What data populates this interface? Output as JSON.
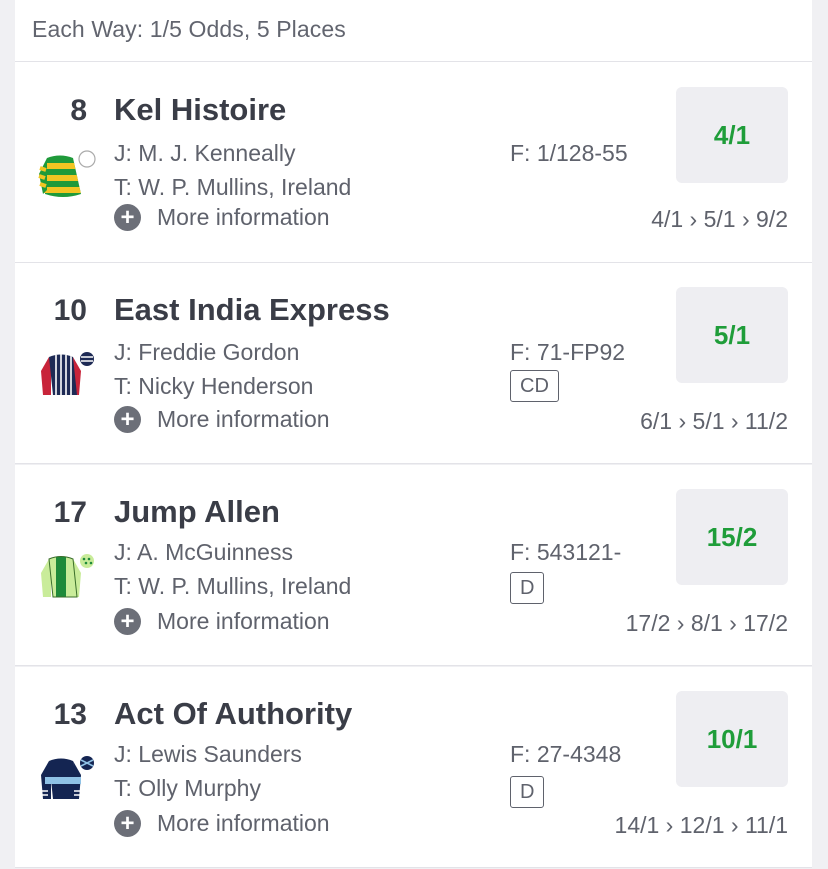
{
  "header": {
    "each_way": "Each Way: 1/5 Odds, 5 Places"
  },
  "more_label": "More information",
  "runners": [
    {
      "number": "8",
      "name": "Kel Histoire",
      "jockey": "J: M. J. Kenneally",
      "trainer": "T: W. P. Mullins, Ireland",
      "form": "F: 1/128-55",
      "badge": "",
      "odds": "4/1",
      "history": "4/1 › 5/1 › 9/2",
      "silk": "green-yellow-hoops"
    },
    {
      "number": "10",
      "name": "East India Express",
      "jockey": "J: Freddie Gordon",
      "trainer": "T: Nicky Henderson",
      "form": "F: 71-FP92",
      "badge": "CD",
      "odds": "5/1",
      "history": "6/1 › 5/1 › 11/2",
      "silk": "navy-stripes-red-sleeves"
    },
    {
      "number": "17",
      "name": "Jump Allen",
      "jockey": "J: A. McGuinness",
      "trainer": "T: W. P. Mullins, Ireland",
      "form": "F: 543121-",
      "badge": "D",
      "odds": "15/2",
      "history": "17/2 › 8/1 › 17/2",
      "silk": "green-light-green"
    },
    {
      "number": "13",
      "name": "Act Of Authority",
      "jockey": "J: Lewis Saunders",
      "trainer": "T: Olly Murphy",
      "form": "F: 27-4348",
      "badge": "D",
      "odds": "10/1",
      "history": "14/1 › 12/1 › 11/1",
      "silk": "navy-light-blue-hoop"
    }
  ],
  "colors": {
    "odds_text": "#1f9d3a",
    "odds_bg": "#eeeef2",
    "text": "#3a3d47",
    "muted": "#5f626c"
  }
}
